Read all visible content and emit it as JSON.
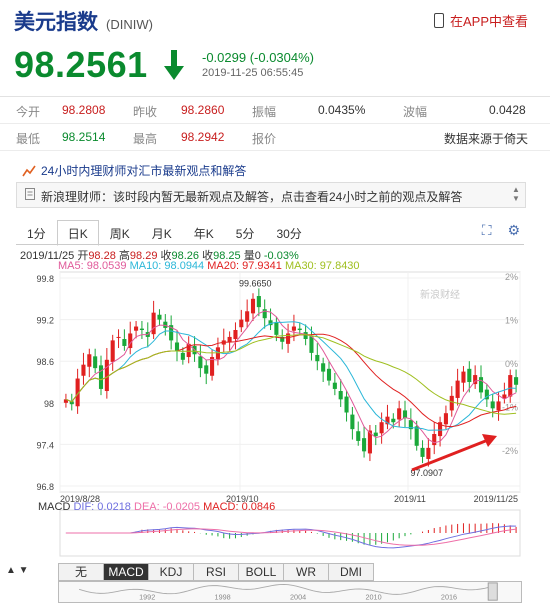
{
  "header": {
    "name": "美元指数",
    "code": "(DINIW)",
    "app_link": "在APP中查看"
  },
  "quote": {
    "price": "98.2561",
    "change": "-0.0299 (-0.0304%)",
    "timestamp": "2019-11-25 06:55:45"
  },
  "stats": [
    [
      {
        "label": "今开",
        "value": "98.2808"
      },
      {
        "label": "昨收",
        "value": "98.2860"
      },
      {
        "label": "振幅",
        "value": "0.0435%"
      },
      {
        "label": "波幅",
        "value": "0.0428"
      }
    ],
    [
      {
        "label": "最低",
        "value": "98.2514"
      },
      {
        "label": "最高",
        "value": "98.2942"
      },
      {
        "label": "报价",
        "value": "数据来源于倚天"
      }
    ]
  ],
  "news": {
    "title": "24小时内理财师对汇市最新观点和解答",
    "text": "新浪理财师：该时段内暂无最新观点及解答，点击查看24小时之前的观点及解答"
  },
  "tabs": [
    "1分",
    "日K",
    "周K",
    "月K",
    "年K",
    "5分",
    "30分"
  ],
  "active_tab": "日K",
  "ohlc": {
    "date": "2019/11/25",
    "l_open": "开",
    "open": "98.28",
    "l_high": "高",
    "high": "98.29",
    "l_close": "收",
    "close": "98.26",
    "l_prev": "收",
    "prev": "98.25",
    "l_vol": "量",
    "vol": "0",
    "pct": "-0.03%"
  },
  "ma": {
    "ma5": "MA5: 98.0539",
    "ma10": "MA10: 98.0944",
    "ma20": "MA20: 97.9341",
    "ma30": "MA30: 97.8430"
  },
  "macd": {
    "label": "MACD",
    "dif": "DIF: 0.0218",
    "dea": "DEA: -0.0205",
    "macd": "MACD: 0.0846"
  },
  "indicator_tabs": [
    "无",
    "MACD",
    "KDJ",
    "RSI",
    "BOLL",
    "WR",
    "DMI"
  ],
  "active_indicator": "MACD",
  "chart": {
    "y_ticks": [
      "99.8",
      "99.2",
      "98.6",
      "98",
      "97.4",
      "96.8"
    ],
    "pct_ticks": [
      "2%",
      "1%",
      "0%",
      "-1%",
      "-2%"
    ],
    "x_ticks": [
      "2019/8/28",
      "2019/10",
      "2019/11",
      "2019/11/25"
    ],
    "high_label": "99.6650",
    "low_label": "97.0907",
    "watermark": "新浪财经",
    "nav_years": [
      "1992",
      "1998",
      "2004",
      "2010",
      "2016"
    ]
  },
  "colors": {
    "up": "#e02020",
    "down": "#1aa83a",
    "ma5": "#e05a9a",
    "ma10": "#2bb7d8",
    "ma20": "#e02020",
    "ma30": "#9fbf1f",
    "dif": "#6f6fe0",
    "dea": "#ee6fa8"
  }
}
